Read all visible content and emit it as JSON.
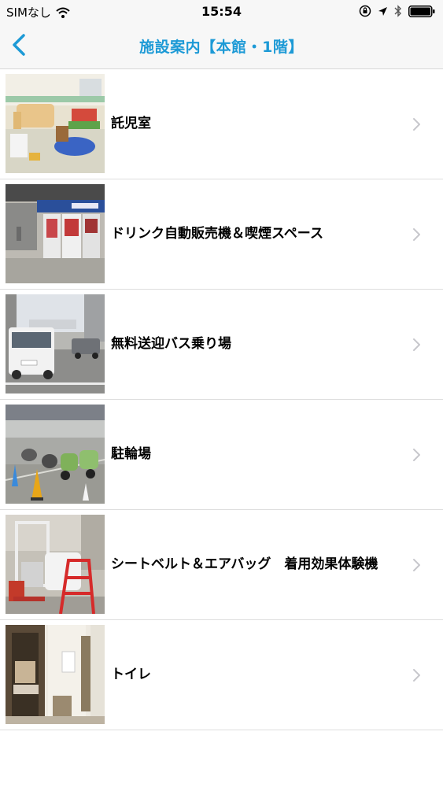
{
  "status_bar": {
    "carrier": "SIMなし",
    "time": "15:54"
  },
  "nav": {
    "title": "施設案内【本館・1階】"
  },
  "colors": {
    "accent": "#1d9ad6",
    "chevron": "#c7c7cc",
    "separator": "#dedede"
  },
  "items": [
    {
      "label": "託児室"
    },
    {
      "label": "ドリンク自動販売機＆喫煙スペース"
    },
    {
      "label": "無料送迎バス乗り場"
    },
    {
      "label": "駐輪場"
    },
    {
      "label": "シートベルト＆エアバッグ　着用効果体験機"
    },
    {
      "label": "トイレ"
    }
  ]
}
